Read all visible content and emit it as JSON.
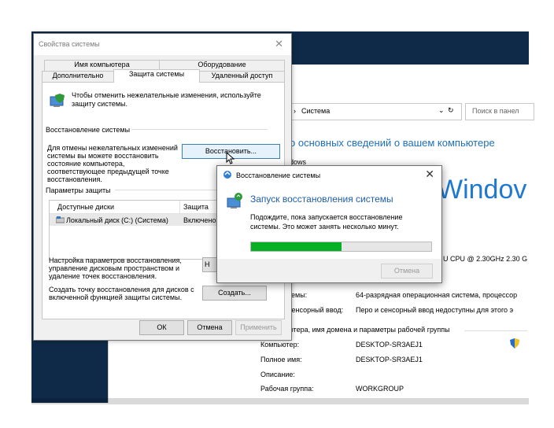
{
  "props": {
    "title": "Свойства системы",
    "tabs_row1": [
      "Имя компьютера",
      "Оборудование"
    ],
    "tabs_row2": [
      "Дополнительно",
      "Защита системы",
      "Удаленный доступ"
    ],
    "intro": "Чтобы отменить нежелательные изменения, используйте защиту системы.",
    "restore_group": "Восстановление системы",
    "restore_text": "Для отмены нежелательных изменений системы вы можете восстановить состояние компьютера, соответствующее предыдущей точке восстановления.",
    "restore_button": "Восстановить...",
    "protection_group": "Параметры защиты",
    "table_headers": [
      "Доступные диски",
      "Защита"
    ],
    "table_row": {
      "disk": "Локальный диск (C:) (Система)",
      "protection": "Включено"
    },
    "configure_text": "Настройка параметров восстановления, управление дисковым пространством и удаление точек восстановления.",
    "configure_button": "Н",
    "create_text": "Создать точку восстановления для дисков с включенной функцией защиты системы.",
    "create_button": "Создать...",
    "ok": "ОК",
    "cancel": "Отмена",
    "apply": "Применить"
  },
  "restore": {
    "title": "Восстановление системы",
    "heading": "Запуск восстановления системы",
    "body": "Подождите, пока запускается восстановление системы. Это может занять несколько минут.",
    "progress": 0.5,
    "cancel": "Отмена",
    "progress_color": "#06b025"
  },
  "system": {
    "path": "Система",
    "search_placeholder": "Поиск в панел",
    "heading": "о основных сведений о вашем компьютере",
    "edition_label": "dows",
    "logo": "Windov",
    "cpu": "U CPU @ 2.30GHz   2.30 G",
    "row_systype_label": "темы:",
    "row_systype_value": "64-разрядная операционная система, процессор",
    "row_pen_label": "сенсорный ввод:",
    "row_pen_value": "Перо и сенсорный ввод недоступны для этого э",
    "section": "ютера, имя домена и параметры рабочей группы",
    "computer_label": "Компьютер:",
    "computer_value": "DESKTOP-SR3AEJ1",
    "fullname_label": "Полное имя:",
    "fullname_value": "DESKTOP-SR3AEJ1",
    "desc_label": "Описание:",
    "workgroup_label": "Рабочая группа:",
    "workgroup_value": "WORKGROUP"
  }
}
